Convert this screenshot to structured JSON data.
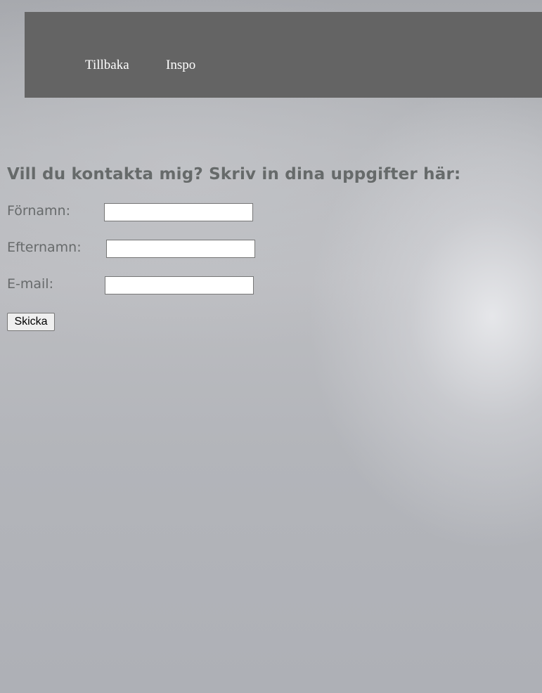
{
  "nav": {
    "back_label": "Tillbaka",
    "inspo_label": "Inspo"
  },
  "form": {
    "heading": "Vill du kontakta mig? Skriv in dina uppgifter här:",
    "first_name_label": "Förnamn:",
    "first_name_value": "",
    "last_name_label": "Efternamn:",
    "last_name_value": "",
    "email_label": "E-mail:",
    "email_value": "",
    "submit_label": "Skicka"
  },
  "colors": {
    "navbar_bg": "#646464",
    "nav_text": "#ffffff",
    "heading_text": "#666a6a",
    "label_text": "#676a6b"
  }
}
